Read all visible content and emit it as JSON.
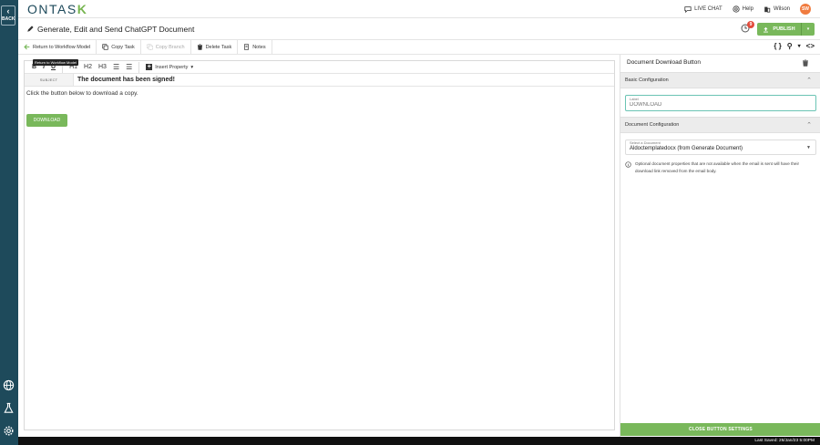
{
  "rail": {
    "back_label": "BACK",
    "icons": [
      "globe-icon",
      "flask-icon",
      "gear-icon"
    ]
  },
  "header": {
    "logo_text": "ONTAS",
    "logo_accent": "K",
    "live_chat": "LIVE CHAT",
    "help": "Help",
    "user": "Wilson",
    "avatar_initials": "SW"
  },
  "titlebar": {
    "title": "Generate, Edit and Send ChatGPT Document",
    "notification_count": "9",
    "publish_label": "PUBLISH"
  },
  "toolbar": {
    "return_label": "Return to Workflow Model",
    "copy_task": "Copy Task",
    "copy_branch": "Copy Branch",
    "delete_task": "Delete Task",
    "notes": "Notes",
    "right_icons": [
      "{ }",
      "⚲",
      "▾",
      "<>"
    ]
  },
  "editor": {
    "tooltip": "Return to Workflow Model",
    "format_buttons": [
      "B",
      "I",
      "U",
      "H1",
      "H2",
      "H3"
    ],
    "insert_property": "Insert Property",
    "subject_label": "SUBJECT",
    "subject_value": "The document has been signed!",
    "body_text": "Click the button below to download a copy.",
    "download_button": "DOWNLOAD"
  },
  "panel": {
    "title": "Document Download Button",
    "basic_config": "Basic Configuration",
    "label_caption": "Label",
    "label_placeholder": "DOWNLOAD",
    "doc_config": "Document Configuration",
    "select_caption": "Select a Document",
    "select_value": "Aldoctemplatedocx (from Generate Document)",
    "info_text": "Optional document properties that are not available when the email is sent will have their download link removed from the email body.",
    "close_button": "CLOSE BUTTON SETTINGS"
  },
  "statusbar": {
    "last_saved": "Last Saved: 26/Jan/23 5:00PM"
  },
  "colors": {
    "rail": "#1e4a5b",
    "accent_green": "#79b85b",
    "badge_red": "#e24c3c",
    "avatar": "#f07b3f",
    "focus_teal": "#6bc4b4"
  }
}
